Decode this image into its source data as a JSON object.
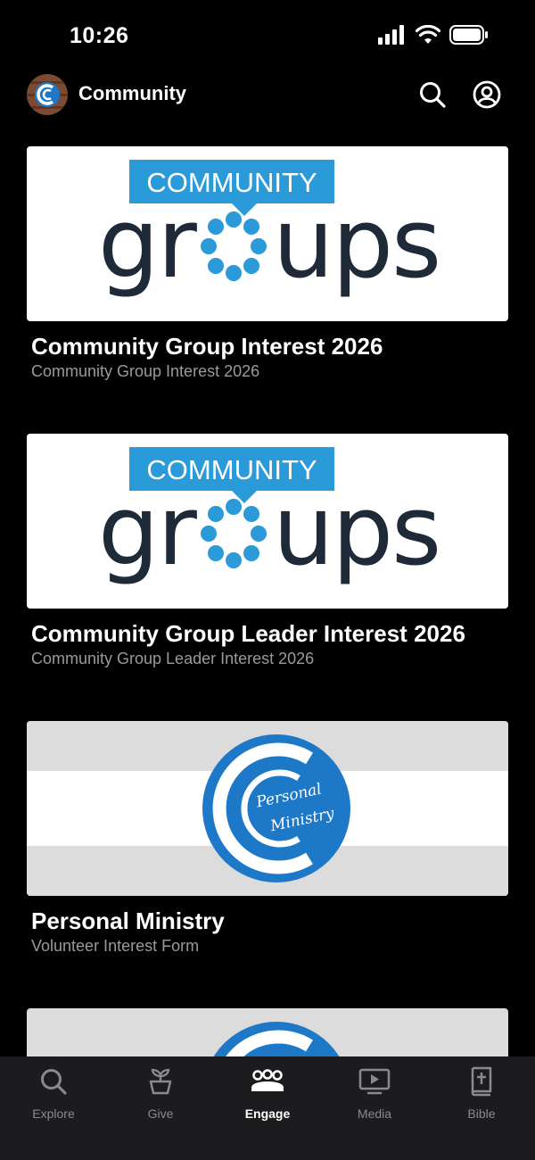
{
  "status_bar": {
    "time": "10:26"
  },
  "header": {
    "title": "Community"
  },
  "cards": [
    {
      "image_text_top": "COMMUNITY",
      "image_text_main": "groups",
      "title": "Community Group Interest 2026",
      "subtitle": "Community Group Interest 2026"
    },
    {
      "image_text_top": "COMMUNITY",
      "image_text_main": "groups",
      "title": "Community Group Leader Interest 2026",
      "subtitle": "Community Group Leader Interest 2026"
    },
    {
      "image_text_script_1": "Personal",
      "image_text_script_2": "Ministry",
      "title": "Personal Ministry",
      "subtitle": "Volunteer Interest Form"
    }
  ],
  "tabs": [
    {
      "label": "Explore",
      "icon": "search-icon"
    },
    {
      "label": "Give",
      "icon": "plant-icon"
    },
    {
      "label": "Engage",
      "icon": "group-icon",
      "active": true
    },
    {
      "label": "Media",
      "icon": "play-screen-icon"
    },
    {
      "label": "Bible",
      "icon": "bible-icon"
    }
  ],
  "colors": {
    "brand_blue": "#1e78c8",
    "logo_dark": "#1f2a38",
    "logo_light_blue": "#2a9ad9",
    "tab_active": "#ffffff",
    "tab_inactive": "#8a8a8e"
  }
}
